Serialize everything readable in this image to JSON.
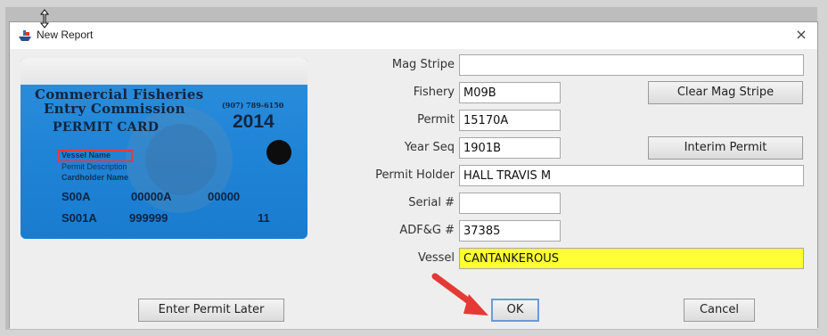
{
  "window": {
    "title": "New Report",
    "close_symbol": "×"
  },
  "card": {
    "title_line1": "Commercial Fisheries",
    "title_line2": "Entry Commission",
    "title_line3": "PERMIT CARD",
    "phone": "(907) 789-6150",
    "year": "2014",
    "vessel_name": "Vessel Name",
    "permit_description": "Permit Description",
    "cardholder_name": "Cardholder Name",
    "row1": [
      "S00A",
      "00000A",
      "00000"
    ],
    "row2": [
      "S001A",
      "999999",
      "11"
    ]
  },
  "form": {
    "mag_stripe": {
      "label": "Mag Stripe",
      "value": ""
    },
    "fishery": {
      "label": "Fishery",
      "value": "M09B"
    },
    "permit": {
      "label": "Permit",
      "value": "15170A"
    },
    "year_seq": {
      "label": "Year Seq",
      "value": "1901B"
    },
    "permit_holder": {
      "label": "Permit Holder",
      "value": "HALL TRAVIS M"
    },
    "serial": {
      "label": "Serial #",
      "value": ""
    },
    "adfg": {
      "label": "ADF&G #",
      "value": "37385"
    },
    "vessel": {
      "label": "Vessel",
      "value": "CANTANKEROUS"
    }
  },
  "buttons": {
    "clear_mag_stripe": "Clear Mag Stripe",
    "interim_permit": "Interim Permit",
    "enter_permit_later": "Enter Permit Later",
    "ok": "OK",
    "cancel": "Cancel"
  },
  "colors": {
    "vessel_highlight": "#ffff33",
    "arrow": "#e53935",
    "card_blue": "#1f83d6"
  },
  "icons": {
    "title": "boat-icon",
    "cursor": "resize-cursor-icon",
    "arrow": "red-arrow-annotation-icon"
  }
}
